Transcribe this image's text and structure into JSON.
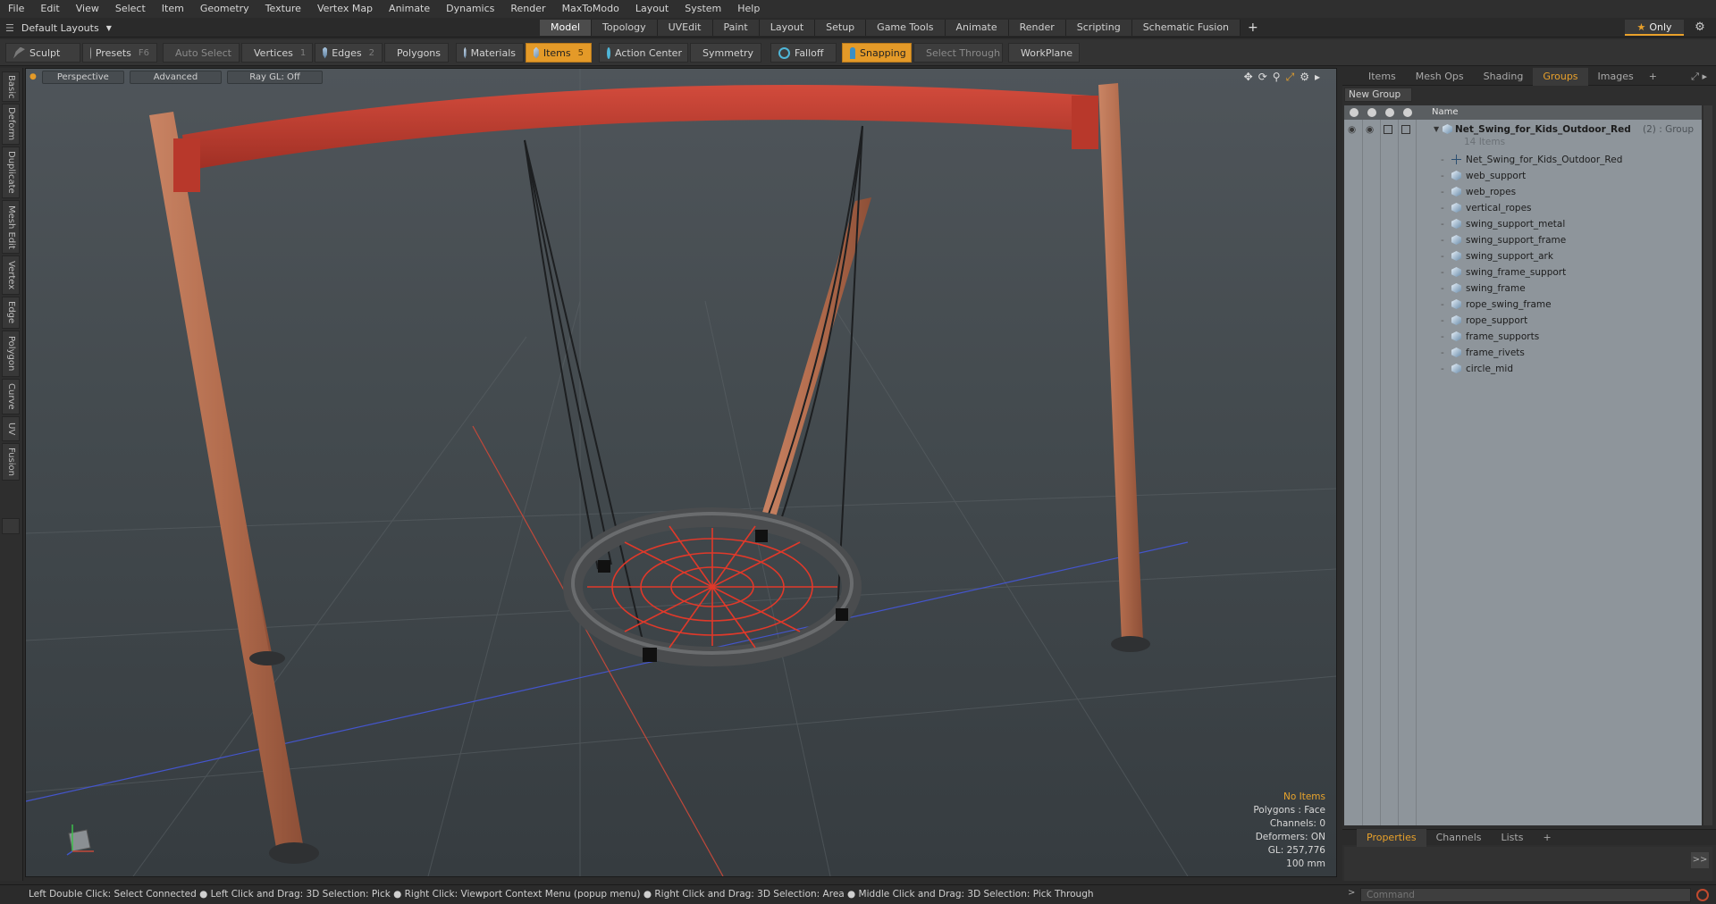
{
  "menu": [
    "File",
    "Edit",
    "View",
    "Select",
    "Item",
    "Geometry",
    "Texture",
    "Vertex Map",
    "Animate",
    "Dynamics",
    "Render",
    "MaxToModo",
    "Layout",
    "System",
    "Help"
  ],
  "layout_select": "Default Layouts",
  "mode_tabs": [
    {
      "label": "Model",
      "active": true
    },
    {
      "label": "Topology",
      "active": false
    },
    {
      "label": "UVEdit",
      "active": false
    },
    {
      "label": "Paint",
      "active": false
    },
    {
      "label": "Layout",
      "active": false
    },
    {
      "label": "Setup",
      "active": false
    },
    {
      "label": "Game Tools",
      "active": false
    },
    {
      "label": "Animate",
      "active": false
    },
    {
      "label": "Render",
      "active": false
    },
    {
      "label": "Scripting",
      "active": false
    },
    {
      "label": "Schematic Fusion",
      "active": false
    }
  ],
  "only_label": "Only",
  "toolbar": {
    "sculpt": "Sculpt",
    "presets": "Presets",
    "presets_key": "F6",
    "auto_select": "Auto Select",
    "vertices": "Vertices",
    "vertices_key": "1",
    "edges": "Edges",
    "edges_key": "2",
    "polygons": "Polygons",
    "materials": "Materials",
    "items": "Items",
    "items_key": "5",
    "action_center": "Action Center",
    "symmetry": "Symmetry",
    "falloff": "Falloff",
    "snapping": "Snapping",
    "select_through": "Select Through",
    "workplane": "WorkPlane"
  },
  "left_tabs": [
    "Basic",
    "Deform",
    "Duplicate",
    "Mesh Edit",
    "Vertex",
    "Edge",
    "Polygon",
    "Curve",
    "UV",
    "Fusion"
  ],
  "viewport": {
    "view": "Perspective",
    "shading": "Advanced",
    "raygl": "Ray GL: Off",
    "info": {
      "no_items": "No Items",
      "polygons": "Polygons : Face",
      "channels": "Channels: 0",
      "deformers": "Deformers: ON",
      "gl": "GL: 257,776",
      "unit": "100 mm"
    }
  },
  "right_panel": {
    "tabs": [
      {
        "label": "Items",
        "active": false
      },
      {
        "label": "Mesh Ops",
        "active": false
      },
      {
        "label": "Shading",
        "active": false
      },
      {
        "label": "Groups",
        "active": true
      },
      {
        "label": "Images",
        "active": false
      }
    ],
    "new_group": "New Group",
    "col_name": "Name",
    "group": {
      "name": "Net_Swing_for_Kids_Outdoor_Red",
      "suffix": "(2) : Group",
      "count": "14 Items"
    },
    "items": [
      {
        "name": "Net_Swing_for_Kids_Outdoor_Red",
        "type": "locator"
      },
      {
        "name": "web_support",
        "type": "mesh"
      },
      {
        "name": "web_ropes",
        "type": "mesh"
      },
      {
        "name": "vertical_ropes",
        "type": "mesh"
      },
      {
        "name": "swing_support_metal",
        "type": "mesh"
      },
      {
        "name": "swing_support_frame",
        "type": "mesh"
      },
      {
        "name": "swing_support_ark",
        "type": "mesh"
      },
      {
        "name": "swing_frame_support",
        "type": "mesh"
      },
      {
        "name": "swing_frame",
        "type": "mesh"
      },
      {
        "name": "rope_swing_frame",
        "type": "mesh"
      },
      {
        "name": "rope_support",
        "type": "mesh"
      },
      {
        "name": "frame_supports",
        "type": "mesh"
      },
      {
        "name": "frame_rivets",
        "type": "mesh"
      },
      {
        "name": "circle_mid",
        "type": "mesh"
      }
    ],
    "bottom_tabs": [
      {
        "label": "Properties",
        "active": true
      },
      {
        "label": "Channels",
        "active": false
      },
      {
        "label": "Lists",
        "active": false
      }
    ]
  },
  "status_bar": "Left Double Click: Select Connected ● Left Click and Drag: 3D Selection: Pick ● Right Click: Viewport Context Menu (popup menu) ● Right Click and Drag: 3D Selection: Area ● Middle Click and Drag: 3D Selection: Pick Through",
  "command_placeholder": "Command",
  "colors": {
    "accent": "#e49a28",
    "frame_red": "#c0392b",
    "wood": "#b06a4a",
    "net_red": "#e0392a"
  }
}
